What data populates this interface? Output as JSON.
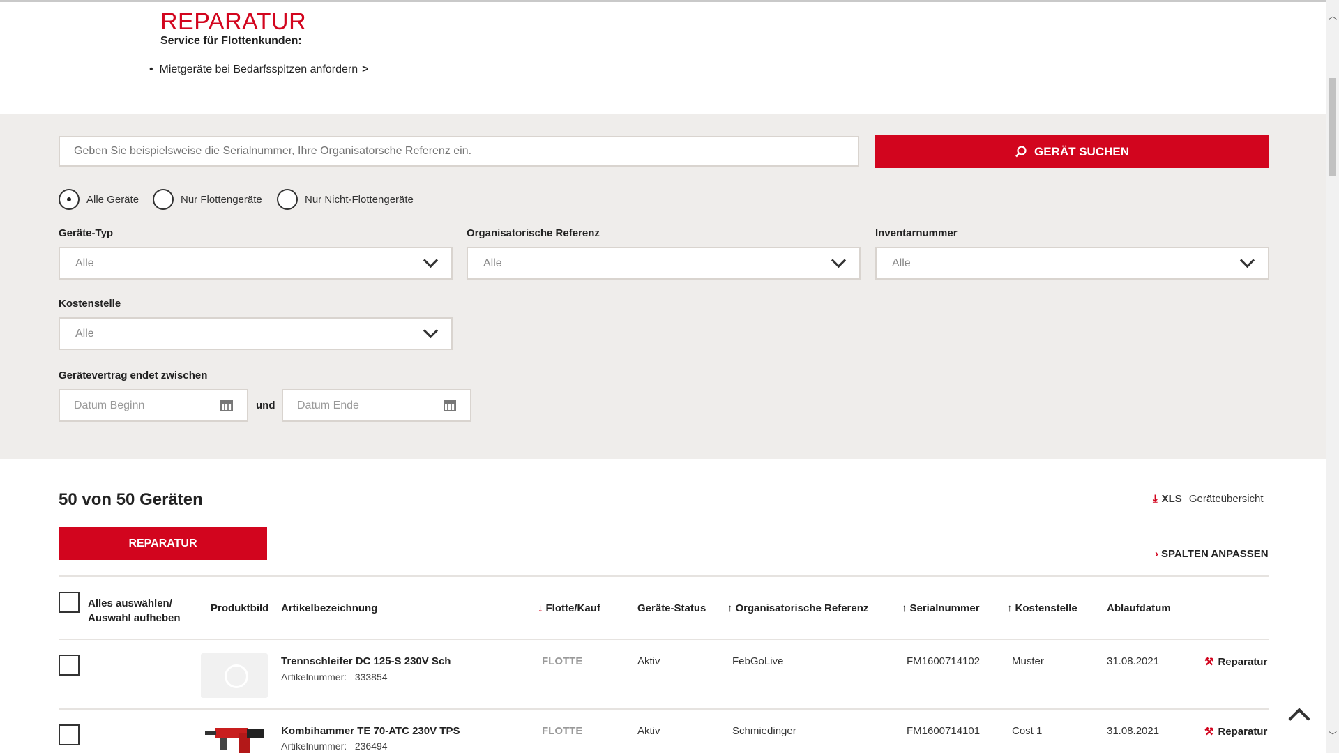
{
  "header": {
    "title": "REPARATUR",
    "subtitle": "Service für Flottenkunden:",
    "bullet_link": "Mietgeräte bei Bedarfsspitzen anfordern",
    "bullet_arrow": ">"
  },
  "search": {
    "placeholder": "Geben Sie beispielsweise die Serialnummer, Ihre Organisatorsche Referenz ein.",
    "button_label": "GERÄT SUCHEN",
    "button_icon": "search-icon"
  },
  "radios": [
    {
      "label": "Alle Geräte",
      "selected": true
    },
    {
      "label": "Nur Flottengeräte",
      "selected": false
    },
    {
      "label": "Nur Nicht-Flottengeräte",
      "selected": false
    }
  ],
  "dropdowns": {
    "geraete_typ": {
      "label": "Geräte-Typ",
      "value": "Alle"
    },
    "org_ref": {
      "label": "Organisatorische Referenz",
      "value": "Alle"
    },
    "inventar": {
      "label": "Inventarnummer",
      "value": "Alle"
    },
    "kostenstelle": {
      "label": "Kostenstelle",
      "value": "Alle"
    }
  },
  "contract": {
    "label": "Gerätevertrag endet zwischen",
    "start_placeholder": "Datum Beginn",
    "connector": "und",
    "end_placeholder": "Datum Ende"
  },
  "results": {
    "count_text": "50 von 50 Geräten",
    "xls_label": "XLS",
    "xls_text": "Geräteübersicht",
    "repair_button": "REPARATUR",
    "columns_link": "SPALTEN ANPASSEN"
  },
  "table": {
    "headers": {
      "select_all_1": "Alles auswählen/",
      "select_all_2": "Auswahl aufheben",
      "image": "Produktbild",
      "article": "Artikelbezeichnung",
      "fleet": "Flotte/Kauf",
      "status": "Geräte-Status",
      "org_ref": "Organisatorische Referenz",
      "serial": "Serialnummer",
      "cost_center": "Kostenstelle",
      "expiry": "Ablaufdatum"
    },
    "rows": [
      {
        "name": "Trennschleifer DC 125-S 230V Sch",
        "article_label": "Artikelnummer:",
        "article_no": "333854",
        "fleet": "FLOTTE",
        "status": "Aktiv",
        "org_ref": "FebGoLive",
        "serial": "FM1600714102",
        "cost_center": "Muster",
        "expiry": "31.08.2021",
        "action": "Reparatur"
      },
      {
        "name": "Kombihammer TE 70-ATC 230V TPS",
        "article_label": "Artikelnummer:",
        "article_no": "236494",
        "fleet": "FLOTTE",
        "status": "Aktiv",
        "org_ref": "Schmiedinger",
        "serial": "FM1600714101",
        "cost_center": "Cost 1",
        "expiry": "31.08.2021",
        "action": "Reparatur"
      }
    ]
  },
  "colors": {
    "accent": "#d2051e",
    "filter_bg": "#efedeb"
  }
}
